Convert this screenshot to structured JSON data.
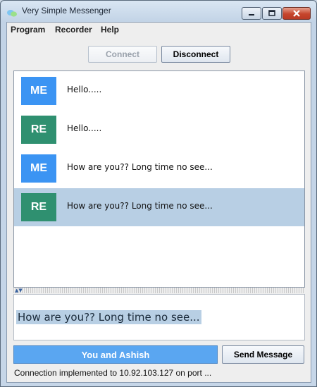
{
  "window": {
    "title": "Very Simple Messenger",
    "icon": "messenger-app-icon"
  },
  "menu": [
    "Program",
    "Recorder",
    "Help"
  ],
  "toolbar": {
    "connect_label": "Connect",
    "connect_enabled": false,
    "disconnect_label": "Disconnect"
  },
  "messages": [
    {
      "sender": "ME",
      "text": "Hello.....",
      "color": "#3b94f3",
      "selected": false
    },
    {
      "sender": "RE",
      "text": "Hello.....",
      "color": "#2f9070",
      "selected": false
    },
    {
      "sender": "ME",
      "text": "How are you?? Long time no see...",
      "color": "#3b94f3",
      "selected": false
    },
    {
      "sender": "RE",
      "text": "How are you?? Long time no see...",
      "color": "#2f9070",
      "selected": true
    }
  ],
  "compose": {
    "value": "How are you?? Long time no see..."
  },
  "contact_label": "You and Ashish",
  "send_label": "Send Message",
  "status_text": "Connection implemented to 10.92.103.127 on port ...",
  "colors": {
    "selection": "#b8cfe4",
    "contact_bar": "#5aa6f1"
  }
}
